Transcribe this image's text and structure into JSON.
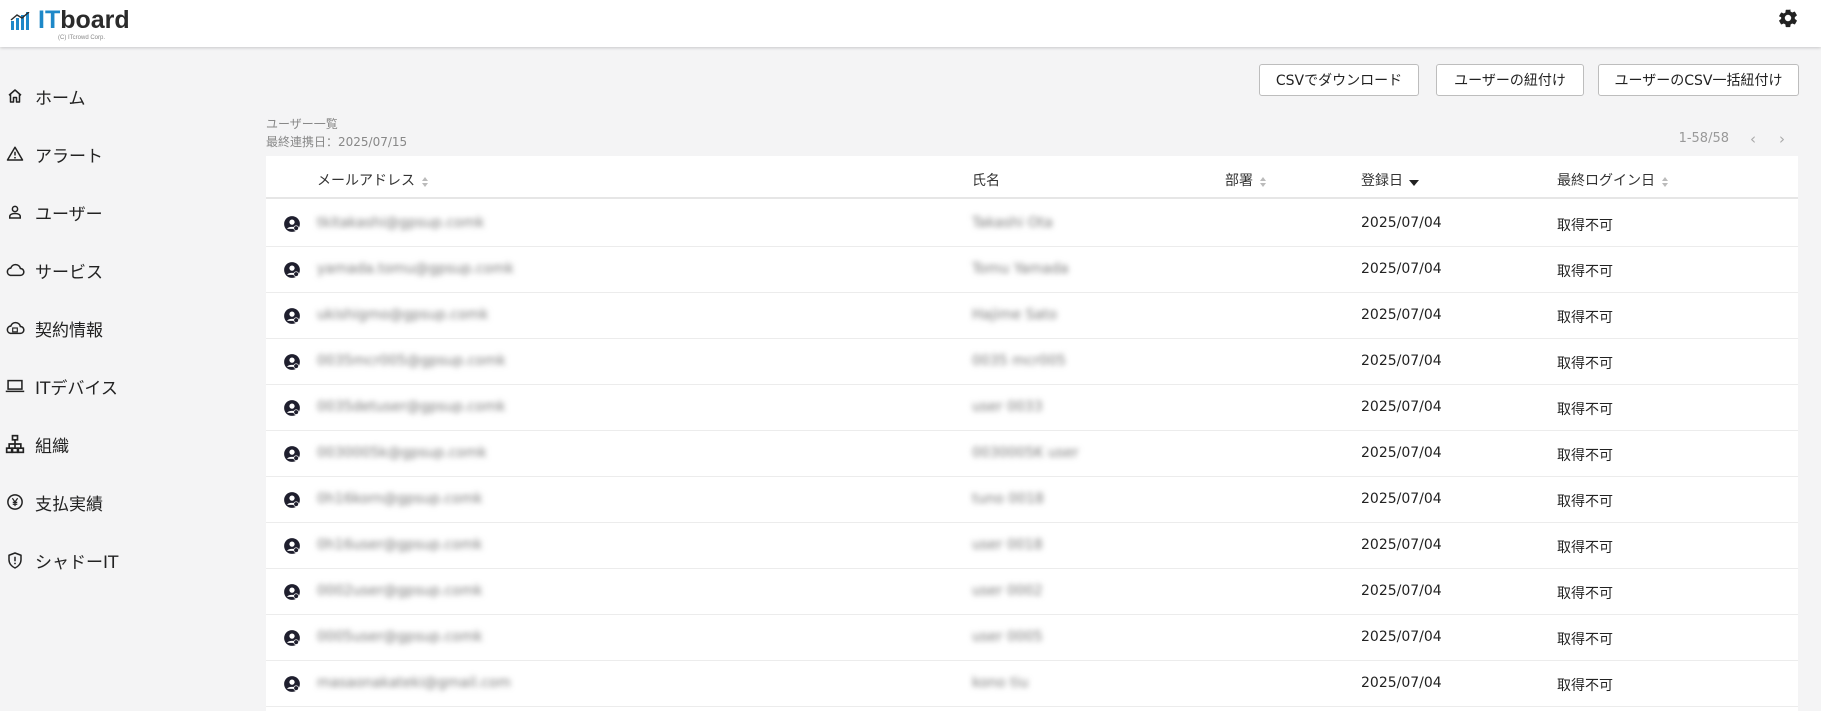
{
  "app": {
    "logo_it": "IT",
    "logo_board": "board",
    "logo_sub": "(C) ITcrowd Corp."
  },
  "sidebar": {
    "items": [
      {
        "label": "ホーム",
        "icon": "home-icon"
      },
      {
        "label": "アラート",
        "icon": "alert-icon"
      },
      {
        "label": "ユーザー",
        "icon": "user-icon"
      },
      {
        "label": "サービス",
        "icon": "cloud-icon"
      },
      {
        "label": "契約情報",
        "icon": "contract-icon"
      },
      {
        "label": "ITデバイス",
        "icon": "laptop-icon"
      },
      {
        "label": "組織",
        "icon": "org-chart-icon"
      },
      {
        "label": "支払実績",
        "icon": "yen-icon"
      },
      {
        "label": "シャドーIT",
        "icon": "shield-icon"
      }
    ]
  },
  "toolbar": {
    "csv_download": "CSVでダウンロード",
    "link_users": "ユーザーの紐付け",
    "csv_bulk_link": "ユーザーのCSV一括紐付け"
  },
  "page": {
    "title": "ユーザー一覧",
    "last_sync": "最終連携日：2025/07/15",
    "pager": "1-58/58"
  },
  "table": {
    "columns": {
      "email": "メールアドレス",
      "name": "氏名",
      "dept": "部署",
      "registered": "登録日",
      "last_login": "最終ログイン日"
    },
    "rows": [
      {
        "email": "tkitakashi@gpsup.comk",
        "name": "Takashi Ota",
        "dept": "",
        "registered": "2025/07/04",
        "last_login": "取得不可"
      },
      {
        "email": "yamada.tomu@gpsup.comk",
        "name": "Tomu Yamada",
        "dept": "",
        "registered": "2025/07/04",
        "last_login": "取得不可"
      },
      {
        "email": "ukishigmo@gpsup.comk",
        "name": "Hajime Sato",
        "dept": "",
        "registered": "2025/07/04",
        "last_login": "取得不可"
      },
      {
        "email": "0035mcr005@gpsup.comk",
        "name": "0035 mcr005",
        "dept": "",
        "registered": "2025/07/04",
        "last_login": "取得不可"
      },
      {
        "email": "0035detuser@gpsup.comk",
        "name": "user 0033",
        "dept": "",
        "registered": "2025/07/04",
        "last_login": "取得不可"
      },
      {
        "email": "0030005k@gpsup.comk",
        "name": "0030005K user",
        "dept": "",
        "registered": "2025/07/04",
        "last_login": "取得不可"
      },
      {
        "email": "0h16korn@gpsup.comk",
        "name": "tuno 0018",
        "dept": "",
        "registered": "2025/07/04",
        "last_login": "取得不可"
      },
      {
        "email": "0h16user@gpsup.comk",
        "name": "user 0018",
        "dept": "",
        "registered": "2025/07/04",
        "last_login": "取得不可"
      },
      {
        "email": "0002user@gpsup.comk",
        "name": "user 0002",
        "dept": "",
        "registered": "2025/07/04",
        "last_login": "取得不可"
      },
      {
        "email": "0005user@gpsup.comk",
        "name": "user 0005",
        "dept": "",
        "registered": "2025/07/04",
        "last_login": "取得不可"
      },
      {
        "email": "masaonakateki@gmail.com",
        "name": "kono tiu",
        "dept": "",
        "registered": "2025/07/04",
        "last_login": "取得不可"
      }
    ]
  },
  "colors": {
    "brand_blue": "#1e88c8",
    "background": "#f4f4f5",
    "icon_dark": "#1f1f2e"
  }
}
